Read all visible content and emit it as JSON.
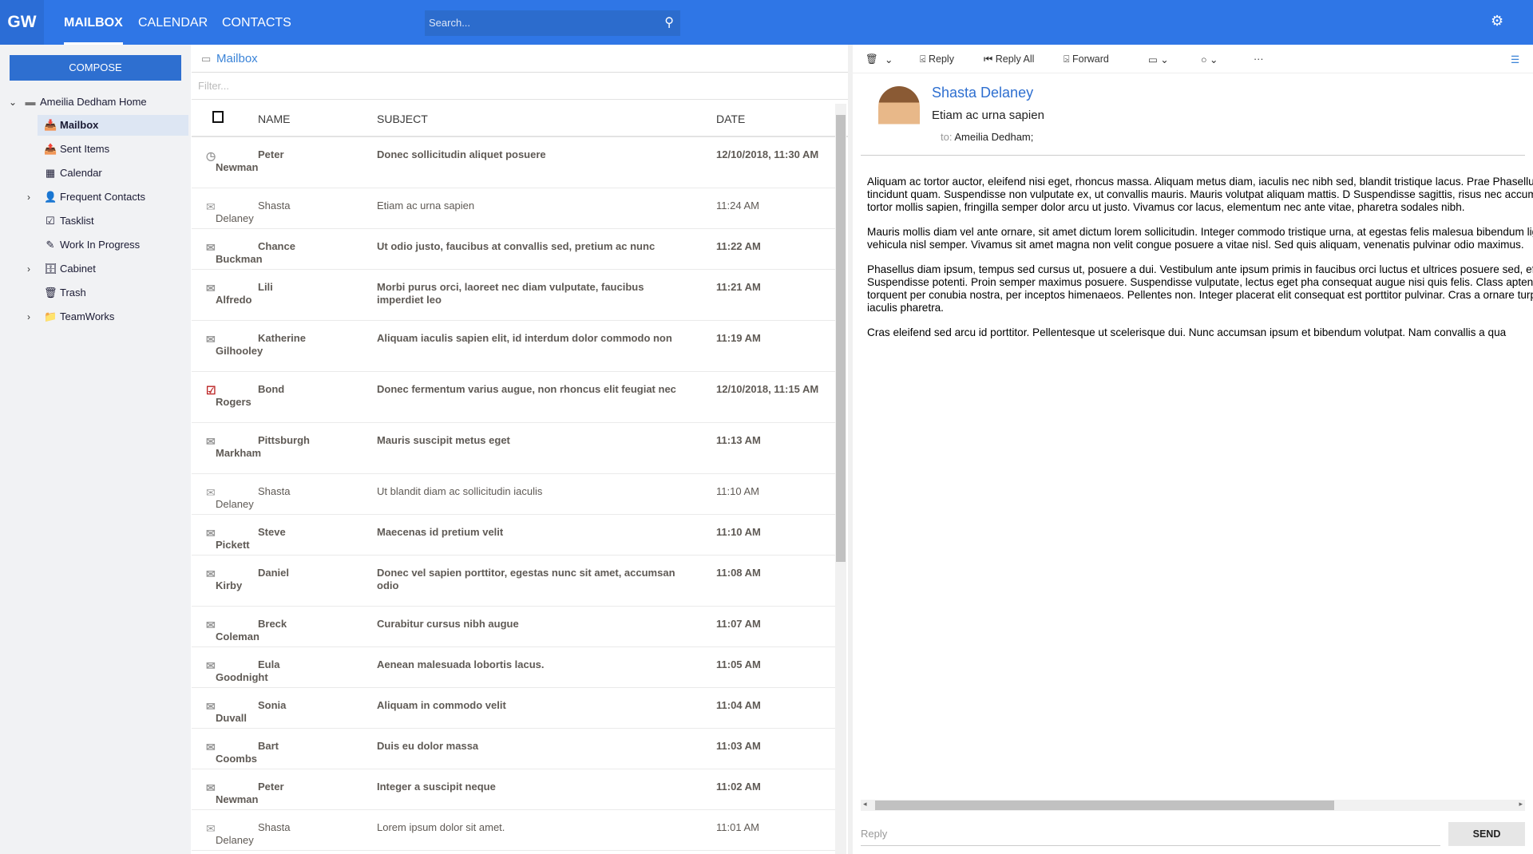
{
  "topbar": {
    "logo": "GW",
    "tabs": [
      "MAILBOX",
      "CALENDAR",
      "CONTACTS"
    ],
    "search_placeholder": "Search..."
  },
  "sidebar": {
    "compose": "COMPOSE",
    "home": "Ameilia Dedham Home",
    "items": [
      {
        "label": "Mailbox",
        "icon": "inbox-icon",
        "glyph": "📥",
        "chev": false
      },
      {
        "label": "Sent Items",
        "icon": "sent-icon",
        "glyph": "📤",
        "chev": false
      },
      {
        "label": "Calendar",
        "icon": "calendar-icon",
        "glyph": "▦",
        "chev": false
      },
      {
        "label": "Frequent Contacts",
        "icon": "contacts-icon",
        "glyph": "👤",
        "chev": true
      },
      {
        "label": "Tasklist",
        "icon": "tasklist-icon",
        "glyph": "☑",
        "chev": false
      },
      {
        "label": "Work In Progress",
        "icon": "draft-icon",
        "glyph": "✎",
        "chev": false
      },
      {
        "label": "Cabinet",
        "icon": "cabinet-icon",
        "glyph": "🗄",
        "chev": true
      },
      {
        "label": "Trash",
        "icon": "trash-icon",
        "glyph": "🗑",
        "chev": false
      },
      {
        "label": "TeamWorks",
        "icon": "folder-icon",
        "glyph": "📁",
        "chev": true
      }
    ]
  },
  "list": {
    "title": "Mailbox",
    "filter_placeholder": "Filter...",
    "columns": {
      "name": "NAME",
      "subject": "SUBJECT",
      "date": "DATE"
    },
    "rows": [
      {
        "name": "Peter Newman",
        "subject": "Donec sollicitudin aliquet posuere",
        "date": "12/10/2018, 11:30 AM",
        "icon": "clock",
        "unread": true,
        "h": 64
      },
      {
        "name": "Shasta Delaney",
        "subject": "Etiam ac urna sapien",
        "date": "11:24 AM",
        "icon": "opened",
        "unread": false,
        "h": 51
      },
      {
        "name": "Chance Buckman",
        "subject": "Ut odio justo, faucibus at convallis sed, pretium ac nunc",
        "date": "11:22 AM",
        "icon": "mail",
        "unread": true,
        "h": 51
      },
      {
        "name": "Lili Alfredo",
        "subject": "Morbi purus orci, laoreet nec diam vulputate, faucibus imperdiet leo",
        "date": "11:21 AM",
        "icon": "mail",
        "unread": true,
        "h": 64
      },
      {
        "name": "Katherine Gilhooley",
        "subject": "Aliquam iaculis sapien elit, id interdum dolor commodo non",
        "date": "11:19 AM",
        "icon": "mail",
        "unread": true,
        "h": 64
      },
      {
        "name": "Bond Rogers",
        "subject": "Donec fermentum varius augue, non rhoncus elit feugiat nec",
        "date": "12/10/2018, 11:15 AM",
        "icon": "task",
        "unread": true,
        "h": 64
      },
      {
        "name": "Pittsburgh Markham",
        "subject": "Mauris suscipit metus eget",
        "date": "11:13 AM",
        "icon": "mail",
        "unread": true,
        "h": 64
      },
      {
        "name": "Shasta Delaney",
        "subject": "Ut blandit diam ac sollicitudin iaculis",
        "date": "11:10 AM",
        "icon": "opened",
        "unread": false,
        "h": 51
      },
      {
        "name": "Steve Pickett",
        "subject": "Maecenas id pretium velit",
        "date": "11:10 AM",
        "icon": "mail",
        "unread": true,
        "h": 51
      },
      {
        "name": "Daniel Kirby",
        "subject": "Donec vel sapien porttitor, egestas nunc sit amet, accumsan odio",
        "date": "11:08 AM",
        "icon": "mail",
        "unread": true,
        "h": 64
      },
      {
        "name": "Breck Coleman",
        "subject": "Curabitur cursus nibh augue",
        "date": "11:07 AM",
        "icon": "mail",
        "unread": true,
        "h": 51
      },
      {
        "name": "Eula Goodnight",
        "subject": "Aenean malesuada lobortis lacus.",
        "date": "11:05 AM",
        "icon": "mail",
        "unread": true,
        "h": 51
      },
      {
        "name": "Sonia Duvall",
        "subject": "Aliquam in commodo velit",
        "date": "11:04 AM",
        "icon": "mail",
        "unread": true,
        "h": 51
      },
      {
        "name": "Bart Coombs",
        "subject": "Duis eu dolor massa",
        "date": "11:03 AM",
        "icon": "mail",
        "unread": true,
        "h": 51
      },
      {
        "name": "Peter Newman",
        "subject": "Integer a suscipit neque",
        "date": "11:02 AM",
        "icon": "mail",
        "unread": true,
        "h": 51
      },
      {
        "name": "Shasta Delaney",
        "subject": "Lorem ipsum dolor sit amet.",
        "date": "11:01 AM",
        "icon": "opened",
        "unread": false,
        "h": 51
      }
    ]
  },
  "reader": {
    "toolbar": {
      "reply": "Reply",
      "reply_all": "Reply All",
      "forward": "Forward"
    },
    "from": "Shasta Delaney",
    "subject": "Etiam ac urna sapien",
    "to_label": "to:",
    "to": "Ameilia Dedham;",
    "body": [
      "Aliquam ac tortor auctor, eleifend nisi eget, rhoncus massa. Aliquam metus diam, iaculis nec nibh sed, blandit tristique lacus. Prae Phasellus quis placerat nunc, ac tincidunt quam. Suspendisse non vulputate ex, ut convallis mauris. Mauris volutpat aliquam mattis. D Suspendisse sagittis, risus nec accumsan pellentesque, dolor tortor mollis sapien, fringilla semper dolor arcu ut justo. Vivamus cor lacus, elementum nec ante vitae, pharetra sodales nibh.",
      "Mauris mollis diam vel ante ornare, sit amet dictum lorem sollicitudin. Integer commodo tristique urna, at egestas felis malesua bibendum ligula quis odio porta, ac vehicula nisl semper. Vivamus sit amet magna non velit congue posuere a vitae nisl. Sed quis aliquam, venenatis pulvinar odio maximus.",
      "Phasellus diam ipsum, tempus sed cursus ut, posuere a dui. Vestibulum ante ipsum primis in faucibus orci luctus et ultrices posuere sed, efficitur malesuada purus. Suspendisse potenti. Proin semper maximus posuere. Suspendisse vulputate, lectus eget pha consequat augue nisi quis felis. Class aptent taciti sociosqu ad litora torquent per conubia nostra, per inceptos himenaeos. Pellentes non. Integer placerat elit consequat est porttitor pulvinar. Cras a ornare turpis. Cras convallis risus in iaculis pharetra.",
      "Cras eleifend sed arcu id porttitor. Pellentesque ut scelerisque dui. Nunc accumsan ipsum et bibendum volutpat. Nam convallis a qua"
    ],
    "reply_placeholder": "Reply",
    "send": "SEND"
  }
}
